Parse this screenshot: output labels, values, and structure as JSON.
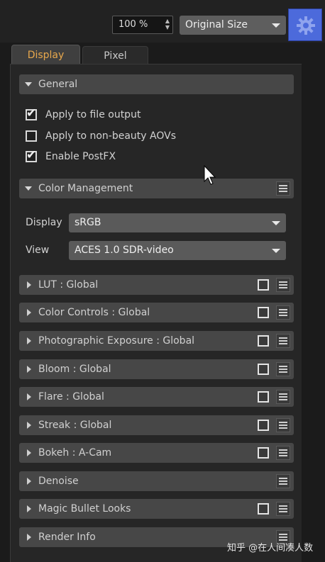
{
  "toolbar": {
    "zoom_value": "100 %",
    "size_select": "Original Size",
    "settings_icon": "gear-icon",
    "accent_color": "#4c6adb"
  },
  "tabs": [
    {
      "label": "Display",
      "active": true
    },
    {
      "label": "Pixel",
      "active": false
    }
  ],
  "general": {
    "title": "General",
    "options": [
      {
        "label": "Apply to file output",
        "checked": true
      },
      {
        "label": "Apply to non-beauty AOVs",
        "checked": false
      },
      {
        "label": "Enable PostFX",
        "checked": true
      }
    ]
  },
  "color_management": {
    "title": "Color Management",
    "display_label": "Display",
    "display_value": "sRGB",
    "view_label": "View",
    "view_value": "ACES 1.0 SDR-video"
  },
  "sections": [
    {
      "label": "LUT  : Global",
      "has_checkbox": true
    },
    {
      "label": "Color Controls  : Global",
      "has_checkbox": true
    },
    {
      "label": "Photographic Exposure  : Global",
      "has_checkbox": true
    },
    {
      "label": "Bloom  : Global",
      "has_checkbox": true
    },
    {
      "label": "Flare  : Global",
      "has_checkbox": true
    },
    {
      "label": "Streak  : Global",
      "has_checkbox": true
    },
    {
      "label": "Bokeh  : A-Cam",
      "has_checkbox": true
    },
    {
      "label": "Denoise",
      "has_checkbox": false
    },
    {
      "label": "Magic Bullet Looks",
      "has_checkbox": true
    },
    {
      "label": "Render Info",
      "has_checkbox": false
    }
  ],
  "watermark": "知乎 @在人间凑人数"
}
